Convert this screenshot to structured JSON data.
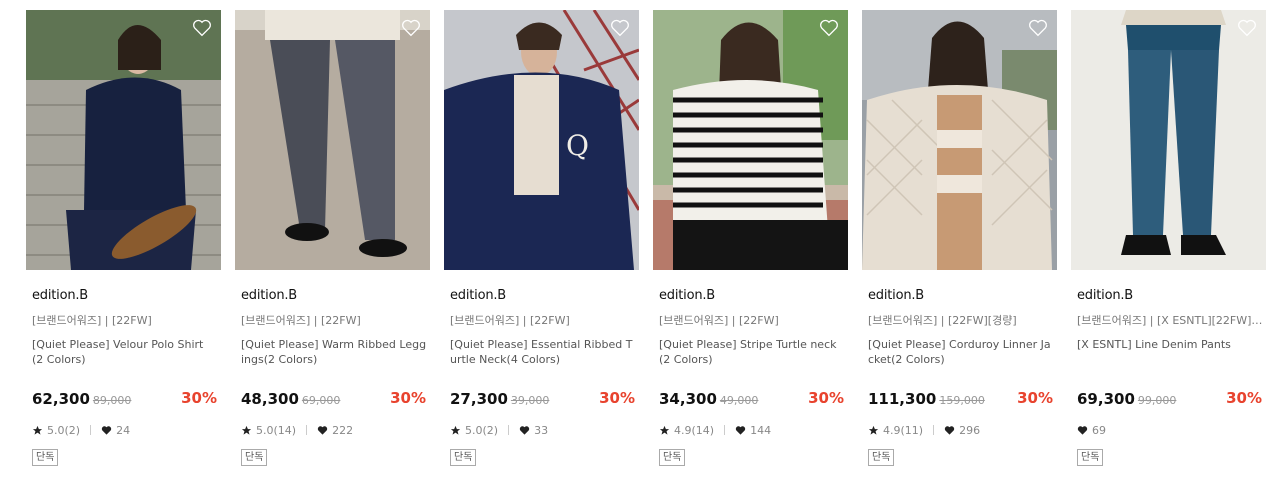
{
  "products": [
    {
      "brand": "edition.B",
      "tags": "[브랜드어워즈] | [22FW]",
      "title": "[Quiet Please] Velour Polo Shirt (2 Colors)",
      "price": "62,300",
      "original_price": "89,000",
      "discount": "30%",
      "rating": "5.0(2)",
      "likes": "24",
      "badge": "단독",
      "image_subject": "model-velour-polo-skateboard"
    },
    {
      "brand": "edition.B",
      "tags": "[브랜드어워즈] | [22FW]",
      "title": "[Quiet Please] Warm Ribbed Leggings(2 Colors)",
      "price": "48,300",
      "original_price": "69,000",
      "discount": "30%",
      "rating": "5.0(14)",
      "likes": "222",
      "badge": "단독",
      "image_subject": "ribbed-leggings-loafers"
    },
    {
      "brand": "edition.B",
      "tags": "[브랜드어워즈] | [22FW]",
      "title": "[Quiet Please] Essential Ribbed Turtle Neck(4 Colors)",
      "price": "27,300",
      "original_price": "39,000",
      "discount": "30%",
      "rating": "5.0(2)",
      "likes": "33",
      "badge": "단독",
      "image_subject": "model-turtleneck-fleece-jacket"
    },
    {
      "brand": "edition.B",
      "tags": "[브랜드어워즈] | [22FW]",
      "title": "[Quiet Please] Stripe Turtle neck(2 Colors)",
      "price": "34,300",
      "original_price": "49,000",
      "discount": "30%",
      "rating": "4.9(14)",
      "likes": "144",
      "badge": "단독",
      "image_subject": "model-stripe-turtleneck"
    },
    {
      "brand": "edition.B",
      "tags": "[브랜드어워즈] | [22FW][경량]",
      "title": "[Quiet Please] Corduroy Linner Jacket(2 Colors)",
      "price": "111,300",
      "original_price": "159,000",
      "discount": "30%",
      "rating": "4.9(11)",
      "likes": "296",
      "badge": "단독",
      "image_subject": "model-quilted-liner-jacket"
    },
    {
      "brand": "edition.B",
      "tags": "[브랜드어워즈] | [X ESNTL][22FW][...",
      "title": "[X ESNTL] Line Denim Pants",
      "price": "69,300",
      "original_price": "99,000",
      "discount": "30%",
      "rating": "",
      "likes": "69",
      "badge": "단독",
      "image_subject": "denim-pants-loafers"
    }
  ],
  "colors": {
    "discount": "#e8432e",
    "price": "#111111",
    "muted": "#888888"
  },
  "icons": {
    "wishlist": "heart-outline-icon",
    "rating": "star-icon",
    "likes": "heart-filled-icon"
  }
}
